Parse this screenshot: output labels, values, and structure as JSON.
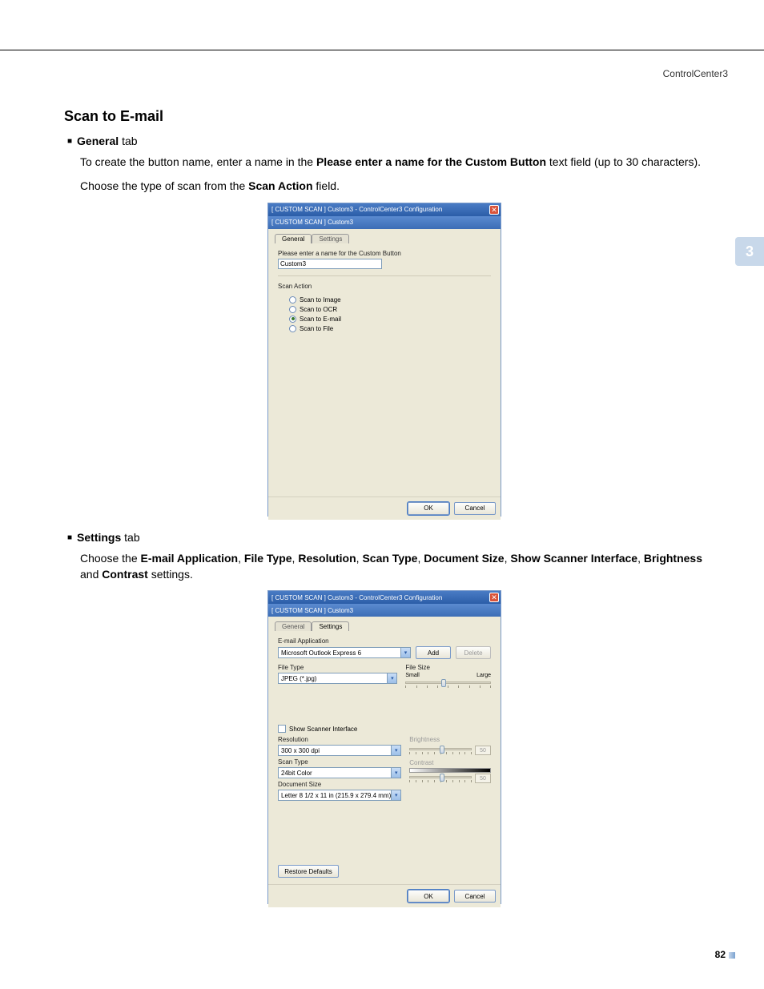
{
  "header": {
    "app": "ControlCenter3"
  },
  "chapter": "3",
  "section_title": "Scan to E-mail",
  "bullets": {
    "general_bold": "General",
    "general_tail": " tab",
    "settings_bold": "Settings",
    "settings_tail": " tab"
  },
  "para1": {
    "lead": "To create the button name, enter a name in the ",
    "bold": "Please enter a name for the Custom Button",
    "tail": " text field (up to 30 characters)."
  },
  "para2": {
    "lead": "Choose the type of scan from the ",
    "bold": "Scan Action",
    "tail": " field."
  },
  "para3": {
    "lead": "Choose the ",
    "b1": "E-mail Application",
    "s1": ", ",
    "b2": "File Type",
    "s2": ", ",
    "b3": "Resolution",
    "s3": ", ",
    "b4": "Scan Type",
    "s4": ", ",
    "b5": "Document Size",
    "s5": ", ",
    "b6": "Show Scanner Interface",
    "s6": ", ",
    "b7": "Brightness",
    "s7": " and ",
    "b8": "Contrast",
    "s8": " settings."
  },
  "dialog1": {
    "title": "[  CUSTOM SCAN  ]   Custom3 - ControlCenter3 Configuration",
    "subtitle": "[  CUSTOM SCAN  ]   Custom3",
    "tab_general": "General",
    "tab_settings": "Settings",
    "name_label": "Please enter a name for the Custom Button",
    "name_value": "Custom3",
    "scan_action_label": "Scan Action",
    "radios": {
      "image": "Scan to Image",
      "ocr": "Scan to OCR",
      "email": "Scan to E-mail",
      "file": "Scan to File"
    },
    "ok": "OK",
    "cancel": "Cancel"
  },
  "dialog2": {
    "title": "[  CUSTOM SCAN  ]   Custom3 - ControlCenter3 Configuration",
    "subtitle": "[  CUSTOM SCAN  ]   Custom3",
    "tab_general": "General",
    "tab_settings": "Settings",
    "email_app_label": "E-mail Application",
    "email_app_value": "Microsoft Outlook Express 6",
    "add": "Add",
    "delete": "Delete",
    "filetype_label": "File Type",
    "filetype_value": "JPEG (*.jpg)",
    "filesize_label": "File Size",
    "filesize_small": "Small",
    "filesize_large": "Large",
    "show_scanner": "Show Scanner Interface",
    "resolution_label": "Resolution",
    "resolution_value": "300 x 300 dpi",
    "scantype_label": "Scan Type",
    "scantype_value": "24bit Color",
    "docsize_label": "Document Size",
    "docsize_value": "Letter 8 1/2 x 11 in (215.9 x 279.4 mm)",
    "brightness_label": "Brightness",
    "brightness_value": "50",
    "contrast_label": "Contrast",
    "contrast_value": "50",
    "restore": "Restore Defaults",
    "ok": "OK",
    "cancel": "Cancel"
  },
  "page_number": "82"
}
